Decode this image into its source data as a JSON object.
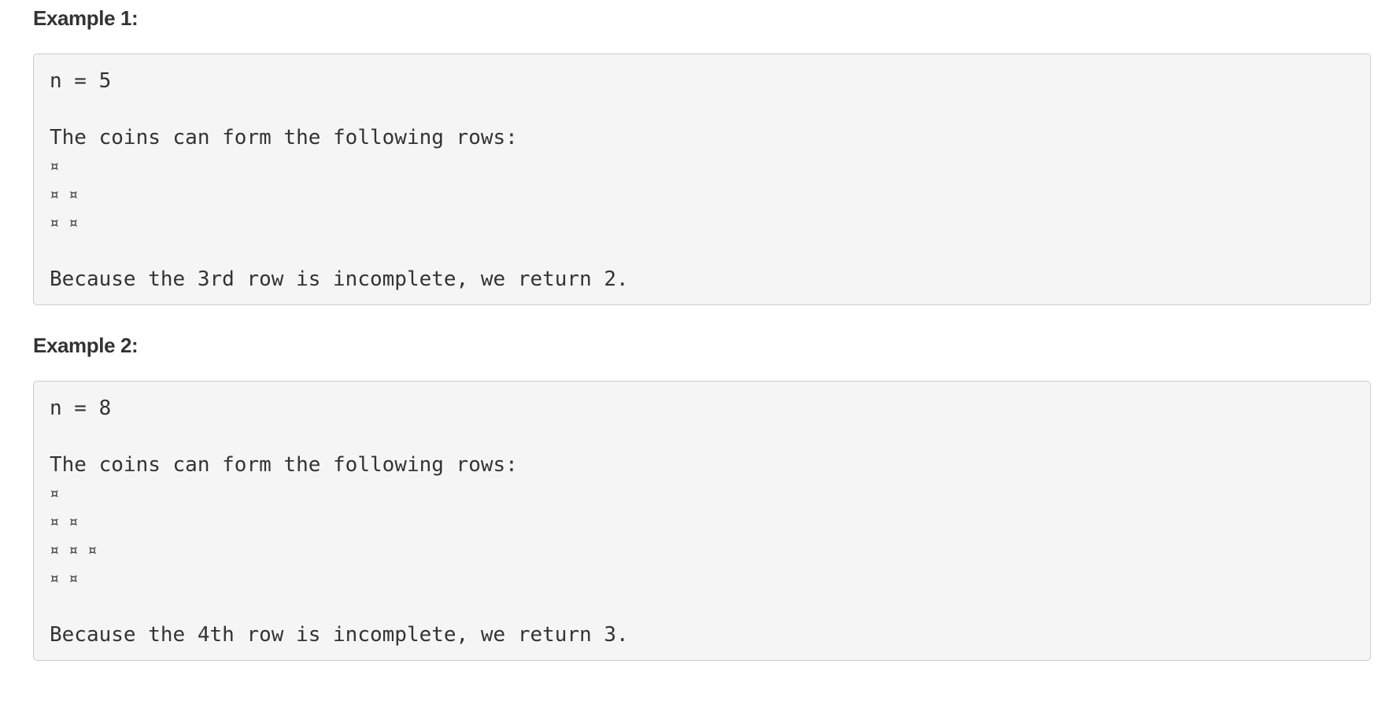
{
  "examples": [
    {
      "heading": "Example 1:",
      "input": "n = 5",
      "intro": "The coins can form the following rows:",
      "rows": [
        "¤",
        "¤ ¤",
        "¤ ¤"
      ],
      "explanation": "Because the 3rd row is incomplete, we return 2."
    },
    {
      "heading": "Example 2:",
      "input": "n = 8",
      "intro": "The coins can form the following rows:",
      "rows": [
        "¤",
        "¤ ¤",
        "¤ ¤ ¤",
        "¤ ¤"
      ],
      "explanation": "Because the 4th row is incomplete, we return 3."
    }
  ]
}
